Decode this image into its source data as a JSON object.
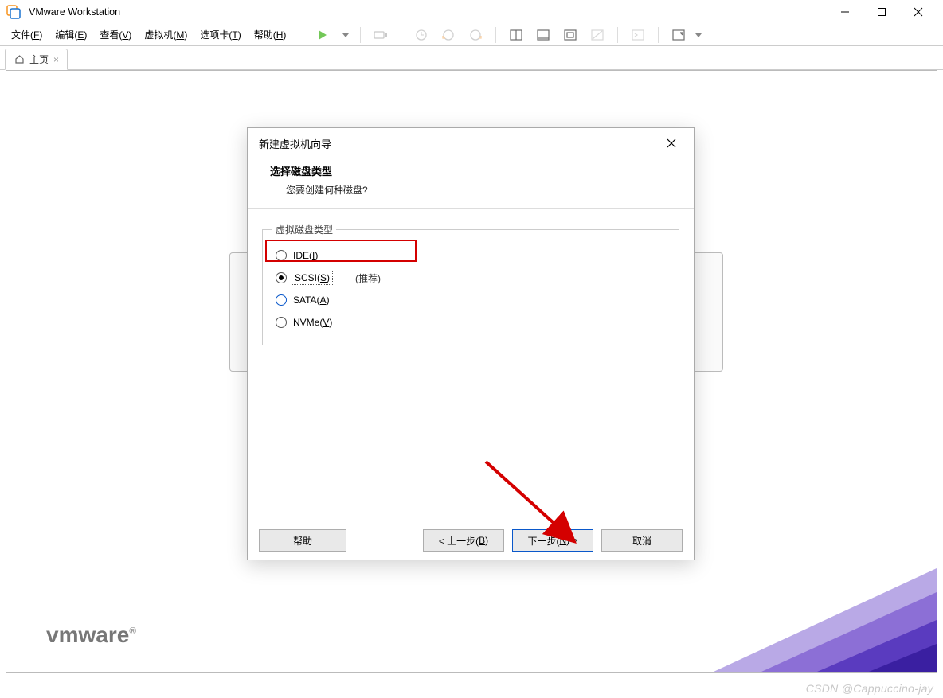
{
  "titlebar": {
    "app_title": "VMware Workstation"
  },
  "window_controls": {
    "minimize": "minimize",
    "maximize": "maximize",
    "close": "close"
  },
  "menubar": {
    "items": [
      {
        "label": "文件(F)",
        "hotkey": "F"
      },
      {
        "label": "编辑(E)",
        "hotkey": "E"
      },
      {
        "label": "查看(V)",
        "hotkey": "V"
      },
      {
        "label": "虚拟机(M)",
        "hotkey": "M"
      },
      {
        "label": "选项卡(T)",
        "hotkey": "T"
      },
      {
        "label": "帮助(H)",
        "hotkey": "H"
      }
    ]
  },
  "tabs": {
    "home_label": "主页"
  },
  "watermark": {
    "brand": "vmware",
    "reg": "®"
  },
  "csdn_text": "CSDN @Cappuccino-jay",
  "dialog": {
    "title": "新建虚拟机向导",
    "heading": "选择磁盘类型",
    "subheading": "您要创建何种磁盘?",
    "group_title": "虚拟磁盘类型",
    "options": [
      {
        "label": "IDE(I)",
        "hotkey": "I",
        "checked": false
      },
      {
        "label": "SCSI(S)",
        "hotkey": "S",
        "checked": true,
        "hint": "(推荐)"
      },
      {
        "label": "SATA(A)",
        "hotkey": "A",
        "checked": false
      },
      {
        "label": "NVMe(V)",
        "hotkey": "V",
        "checked": false
      }
    ],
    "footer": {
      "help": "帮助",
      "back": "< 上一步(B)",
      "next": "下一步(N) >",
      "cancel": "取消"
    }
  }
}
